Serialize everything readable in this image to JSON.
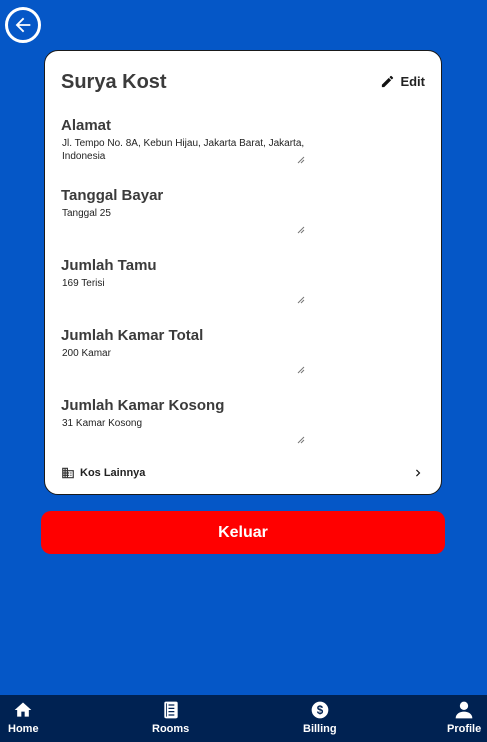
{
  "header": {
    "back_icon": "arrow-left-circle-icon"
  },
  "card": {
    "title": "Surya Kost",
    "edit_label": "Edit",
    "edit_icon": "pencil-icon",
    "fields": [
      {
        "label": "Alamat",
        "value": "Jl. Tempo No. 8A, Kebun Hijau, Jakarta Barat, Jakarta, Indonesia"
      },
      {
        "label": "Tanggal Bayar",
        "value": "Tanggal 25"
      },
      {
        "label": "Jumlah Tamu",
        "value": "169 Terisi"
      },
      {
        "label": "Jumlah Kamar Total",
        "value": "200 Kamar"
      },
      {
        "label": "Jumlah Kamar Kosong",
        "value": "31 Kamar Kosong"
      }
    ],
    "other_kos": {
      "label": "Kos Lainnya",
      "icon": "building-icon",
      "chevron": "chevron-right-icon"
    }
  },
  "logout_label": "Keluar",
  "nav": {
    "items": [
      {
        "label": "Home",
        "icon": "home-icon"
      },
      {
        "label": "Rooms",
        "icon": "book-icon"
      },
      {
        "label": "Billing",
        "icon": "dollar-circle-icon"
      },
      {
        "label": "Profile",
        "icon": "person-icon"
      }
    ]
  },
  "colors": {
    "background": "#0557c7",
    "card": "#ffffff",
    "logout": "#ff0000",
    "nav": "#002252"
  }
}
